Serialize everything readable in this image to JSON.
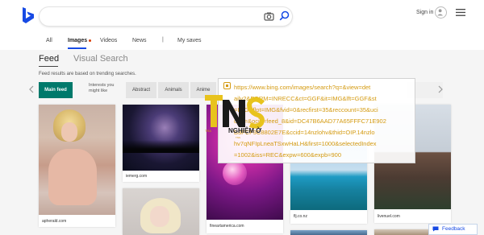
{
  "header": {
    "search_value": "",
    "signin_label": "Sign in",
    "icons": {
      "logo": "bing-logo",
      "camera": "camera-icon",
      "search": "search-icon",
      "avatar": "avatar-icon",
      "menu": "hamburger-icon"
    }
  },
  "nav": {
    "items": [
      "All",
      "Images",
      "Videos",
      "News",
      "|",
      "My saves"
    ],
    "active": "Images",
    "accent_color": "#174ae4",
    "dot_color": "#d83b01"
  },
  "feed": {
    "tabs": [
      "Feed",
      "Visual Search"
    ],
    "subtitle": "Feed results are based on trending searches.",
    "filters": {
      "main": "Main feed",
      "hint": "Interests you might like",
      "chips": [
        "Abstract",
        "Animals",
        "Anime"
      ]
    },
    "main_color": "#00796b"
  },
  "cards": [
    {
      "caption": "apherald.com"
    },
    {
      "caption": "iemerg.com"
    },
    {
      "caption": "fineartamerica.com"
    },
    {
      "caption": "flj.co.nz"
    },
    {
      "caption": "livenuel.com"
    }
  ],
  "tooltip": {
    "color": "#d49a10",
    "lines": [
      "https://www.bing.com/images/search?q=&view=det",
      "ailv2&FORM=INRECC&ct=GGF&it=IMG&lft=GGF&st",
      "=IMG&flpt=IMG&fvid=0&recfirst=35&reccount=35&uci",
      "d=2=&ocid=feed_8&id=DC47B6AAD77A65FFFC71E902",
      "B3FCF3C8802E7E&ccid=14nzlohv&thid=OIP.14nzlo",
      "hv7qNFIpLneaTSxwHaLH&first=1000&selectedIndex",
      "=1002&iss=REC&expw=600&expb=900"
    ]
  },
  "watermark": {
    "logo_text": "TNS",
    "subtitle": "NGHIỆM Ờ",
    "small": "TRA"
  },
  "feedback_label": "Feedback"
}
